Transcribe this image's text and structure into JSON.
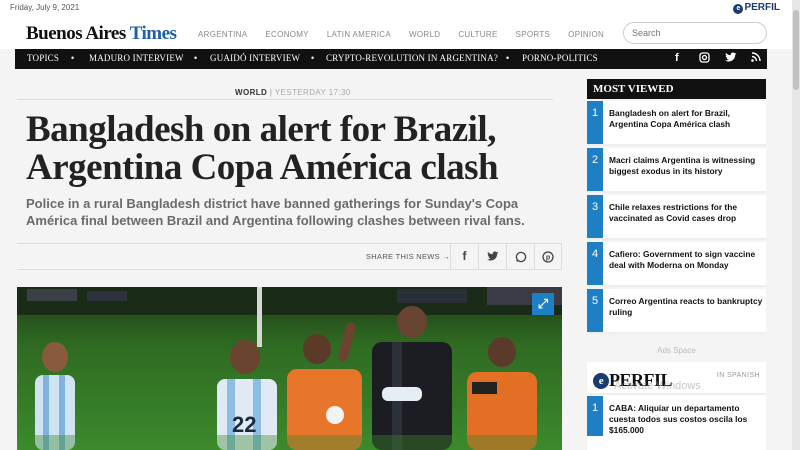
{
  "topbar": {
    "date": "Friday, July 9, 2021",
    "perfil_logo": "PERFIL"
  },
  "header": {
    "logo_main": "Buenos Aires",
    "logo_times": "Times",
    "nav": [
      "ARGENTINA",
      "ECONOMY",
      "LATIN AMERICA",
      "WORLD",
      "CULTURE",
      "SPORTS",
      "OPINION"
    ],
    "search_placeholder": "Search"
  },
  "topics": {
    "label": "TOPICS",
    "items": [
      "MADURO INTERVIEW",
      "GUAIDÓ INTERVIEW",
      "CRYPTO-REVOLUTION IN ARGENTINA?",
      "PORNO-POLITICS"
    ],
    "social_icons": [
      "facebook-icon",
      "instagram-icon",
      "twitter-icon",
      "rss-icon"
    ]
  },
  "article": {
    "section": "WORLD",
    "separator": "|",
    "time": "YESTERDAY 17:30",
    "headline": "Bangladesh on alert for Brazil, Argentina Copa América clash",
    "dek": "Police in a rural Bangladesh district have banned gatherings for Sunday's Copa América final between Brazil and Argentina following clashes between rival fans.",
    "share_label": "SHARE THIS NEWS →",
    "share_icons": [
      "facebook-icon",
      "twitter-icon",
      "whatsapp-icon",
      "pinterest-icon"
    ]
  },
  "sidebar": {
    "most_viewed_title": "MOST VIEWED",
    "most_viewed": [
      {
        "num": "1",
        "text": "Bangladesh on alert for Brazil, Argentina Copa América clash"
      },
      {
        "num": "2",
        "text": "Macri claims Argentina is witnessing biggest exodus in its history"
      },
      {
        "num": "3",
        "text": "Chile relaxes restrictions for the vaccinated as Covid cases drop"
      },
      {
        "num": "4",
        "text": "Cafiero: Government to sign vaccine deal with Moderna on Monday"
      },
      {
        "num": "5",
        "text": "Correo Argentina reacts to bankruptcy ruling"
      }
    ],
    "ads_label": "Ads Space",
    "perfil_logo": "PERFIL",
    "in_spanish": "IN SPANISH",
    "perfil_items": [
      {
        "num": "1",
        "text": "CABA: Aliquiar un departamento cuesta todos sus costos oscila los $165.000"
      }
    ],
    "watermark": "Activate Windows"
  }
}
